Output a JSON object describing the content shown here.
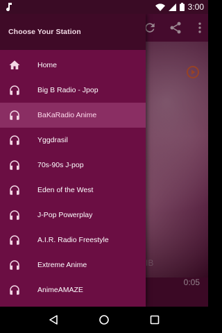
{
  "status_bar": {
    "time": "3:00",
    "icons": [
      "music-note-icon",
      "wifi-icon",
      "cell-signal-icon",
      "battery-icon"
    ]
  },
  "background_app": {
    "toolbar_icons": [
      "refresh-icon",
      "share-icon",
      "more-vert-icon"
    ],
    "partial_text": "IB",
    "elapsed_time": "0:05"
  },
  "drawer": {
    "title": "Choose Your Station",
    "selected_index": 2,
    "items": [
      {
        "label": "Home",
        "icon": "home-icon"
      },
      {
        "label": "Big B Radio - Jpop",
        "icon": "headphones-icon"
      },
      {
        "label": "BaKaRadio Anime",
        "icon": "headphones-icon"
      },
      {
        "label": "Yggdrasil",
        "icon": "headphones-icon"
      },
      {
        "label": "70s-90s J-pop",
        "icon": "headphones-icon"
      },
      {
        "label": "Eden of the West",
        "icon": "headphones-icon"
      },
      {
        "label": "J-Pop Powerplay",
        "icon": "headphones-icon"
      },
      {
        "label": "A.I.R. Radio Freestyle",
        "icon": "headphones-icon"
      },
      {
        "label": "Extreme Anime",
        "icon": "headphones-icon"
      },
      {
        "label": "AnimeAMAZE",
        "icon": "headphones-icon"
      }
    ]
  },
  "nav_bar": {
    "buttons": [
      "back-icon",
      "home-circle-icon",
      "recents-icon"
    ]
  },
  "colors": {
    "drawer_bg": "#6b0e43",
    "drawer_header_bg": "#3f0a27",
    "selected_bg": "#8a2e63",
    "accent": "#e8663a"
  }
}
